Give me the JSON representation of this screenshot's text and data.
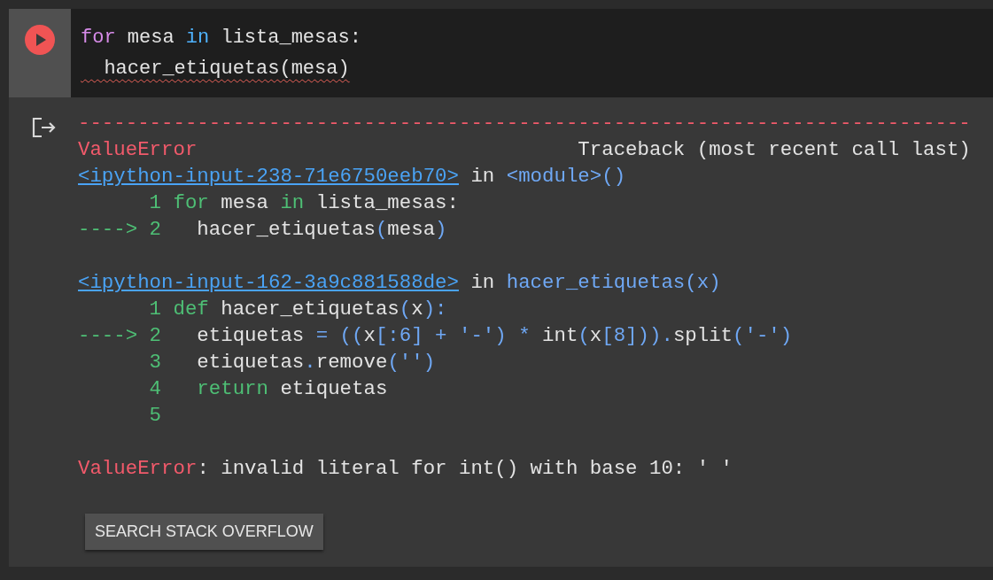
{
  "input": {
    "lines": [
      {
        "error_underline": false,
        "tokens": [
          {
            "text": "for",
            "kind": "kw"
          },
          {
            "text": " mesa ",
            "kind": "plain"
          },
          {
            "text": "in",
            "kind": "kwblue"
          },
          {
            "text": " lista_mesas:",
            "kind": "plain"
          }
        ]
      },
      {
        "error_underline": true,
        "tokens": [
          {
            "text": "  hacer_etiquetas(mesa)",
            "kind": "plain"
          }
        ]
      }
    ]
  },
  "output": {
    "lines": [
      {
        "kind": "code",
        "tokens": [
          {
            "text": "---------------------------------------------------------------------------",
            "kind": "red"
          }
        ]
      },
      {
        "kind": "code",
        "tokens": [
          {
            "text": "ValueError",
            "kind": "red"
          },
          {
            "text": "                                Traceback (most recent call last)",
            "kind": "plain"
          }
        ]
      },
      {
        "kind": "code",
        "tokens": [
          {
            "text": "<ipython-input-238-71e6750eeb70>",
            "kind": "link"
          },
          {
            "text": " in ",
            "kind": "plain"
          },
          {
            "text": "<module>()",
            "kind": "punct"
          }
        ]
      },
      {
        "kind": "code",
        "tokens": [
          {
            "text": "      1 ",
            "kind": "green"
          },
          {
            "text": "for",
            "kind": "green"
          },
          {
            "text": " mesa ",
            "kind": "plain"
          },
          {
            "text": "in",
            "kind": "green"
          },
          {
            "text": " lista_mesas:",
            "kind": "plain"
          }
        ]
      },
      {
        "kind": "code",
        "tokens": [
          {
            "text": "----> 2",
            "kind": "green"
          },
          {
            "text": "   hacer_etiquetas",
            "kind": "plain"
          },
          {
            "text": "(",
            "kind": "punct"
          },
          {
            "text": "mesa",
            "kind": "plain"
          },
          {
            "text": ")",
            "kind": "punct"
          }
        ]
      },
      {
        "kind": "blank"
      },
      {
        "kind": "code",
        "tokens": [
          {
            "text": "<ipython-input-162-3a9c881588de>",
            "kind": "link"
          },
          {
            "text": " in ",
            "kind": "plain"
          },
          {
            "text": "hacer_etiquetas(x)",
            "kind": "punct"
          }
        ]
      },
      {
        "kind": "code",
        "tokens": [
          {
            "text": "      1 ",
            "kind": "green"
          },
          {
            "text": "def",
            "kind": "green"
          },
          {
            "text": " hacer_etiquetas",
            "kind": "plain"
          },
          {
            "text": "(",
            "kind": "punct"
          },
          {
            "text": "x",
            "kind": "plain"
          },
          {
            "text": "):",
            "kind": "punct"
          }
        ]
      },
      {
        "kind": "code",
        "tokens": [
          {
            "text": "----> 2",
            "kind": "green"
          },
          {
            "text": "   etiquetas ",
            "kind": "plain"
          },
          {
            "text": "= ((",
            "kind": "punct"
          },
          {
            "text": "x",
            "kind": "plain"
          },
          {
            "text": "[:6] + '-') * ",
            "kind": "punct"
          },
          {
            "text": "int",
            "kind": "plain"
          },
          {
            "text": "(",
            "kind": "punct"
          },
          {
            "text": "x",
            "kind": "plain"
          },
          {
            "text": "[8])).",
            "kind": "punct"
          },
          {
            "text": "split",
            "kind": "plain"
          },
          {
            "text": "('-')",
            "kind": "punct"
          }
        ]
      },
      {
        "kind": "code",
        "tokens": [
          {
            "text": "      3",
            "kind": "green"
          },
          {
            "text": "   etiquetas",
            "kind": "plain"
          },
          {
            "text": ".",
            "kind": "punct"
          },
          {
            "text": "remove",
            "kind": "plain"
          },
          {
            "text": "('')",
            "kind": "punct"
          }
        ]
      },
      {
        "kind": "code",
        "tokens": [
          {
            "text": "      4   return",
            "kind": "green"
          },
          {
            "text": " etiquetas",
            "kind": "plain"
          }
        ]
      },
      {
        "kind": "code",
        "tokens": [
          {
            "text": "      5",
            "kind": "green"
          }
        ]
      },
      {
        "kind": "blank"
      },
      {
        "kind": "code",
        "tokens": [
          {
            "text": "ValueError",
            "kind": "red"
          },
          {
            "text": ": invalid literal for int() with base 10: ' '",
            "kind": "plain"
          }
        ]
      }
    ]
  },
  "button": {
    "label": "SEARCH STACK OVERFLOW"
  }
}
